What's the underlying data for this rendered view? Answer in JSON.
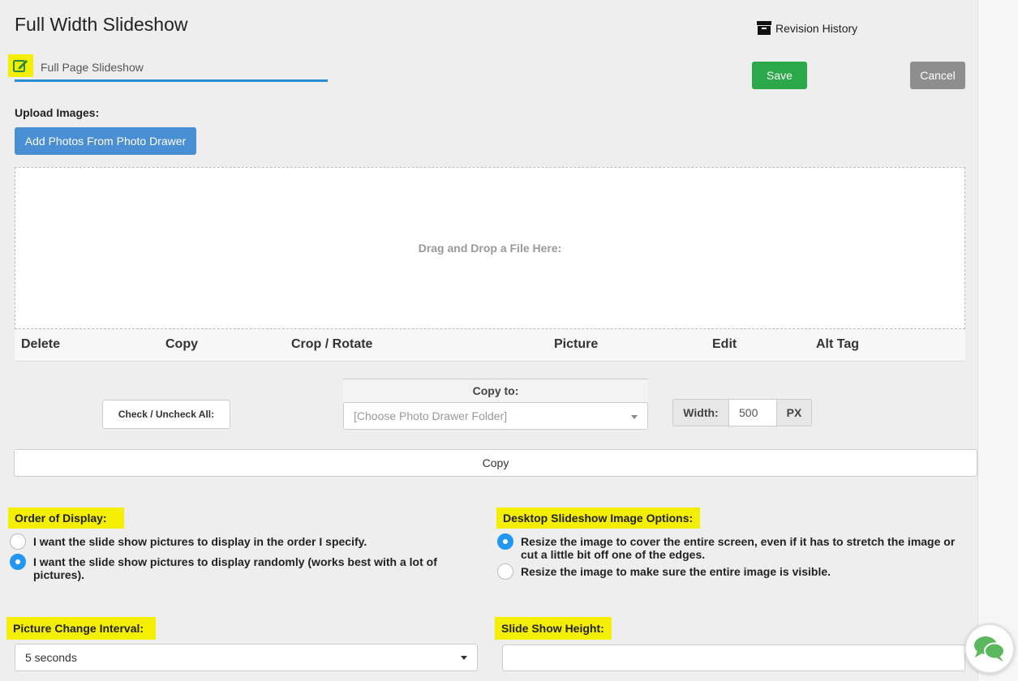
{
  "header": {
    "title": "Full Width Slideshow",
    "revision_history": "Revision History",
    "name_value": "Full Page Slideshow",
    "save_label": "Save",
    "cancel_label": "Cancel"
  },
  "upload": {
    "label": "Upload Images:",
    "add_photos_label": "Add Photos From Photo Drawer",
    "dropzone_text": "Drag and Drop a File Here:"
  },
  "table": {
    "columns": [
      "Delete",
      "Copy",
      "Crop / Rotate",
      "Picture",
      "Edit",
      "Alt Tag"
    ]
  },
  "controls": {
    "check_all_label": "Check / Uncheck All:",
    "copy_to_label": "Copy to:",
    "copy_to_placeholder": "[Choose Photo Drawer Folder]",
    "width_label": "Width:",
    "width_value": "500",
    "width_unit": "PX",
    "copy_button": "Copy"
  },
  "order_of_display": {
    "label": "Order of Display:",
    "options": [
      {
        "text": "I want the slide show pictures to display in the order I specify.",
        "selected": false
      },
      {
        "text": "I want the slide show pictures to display randomly (works best with a lot of pictures).",
        "selected": true
      }
    ]
  },
  "desktop_options": {
    "label": "Desktop Slideshow Image Options:",
    "options": [
      {
        "text": "Resize the image to cover the entire screen, even if it has to stretch the image or cut a little bit off one of the edges.",
        "selected": true
      },
      {
        "text": "Resize the image to make sure the entire image is visible.",
        "selected": false
      }
    ]
  },
  "interval": {
    "label": "Picture Change Interval:",
    "value": "5 seconds"
  },
  "height": {
    "label": "Slide Show Height:",
    "value": ""
  },
  "colors": {
    "save": "#2aa84a",
    "cancel": "#8e8e8e",
    "add_photos": "#4a8fd3",
    "highlight": "#f4ef00",
    "radio_selected": "#2196f3",
    "underline": "#2a8fd0",
    "chat": "#5cb85c"
  },
  "icons": {
    "edit": "edit-pencil-icon",
    "archive": "archive-box-icon",
    "chat": "chat-bubbles-icon"
  }
}
